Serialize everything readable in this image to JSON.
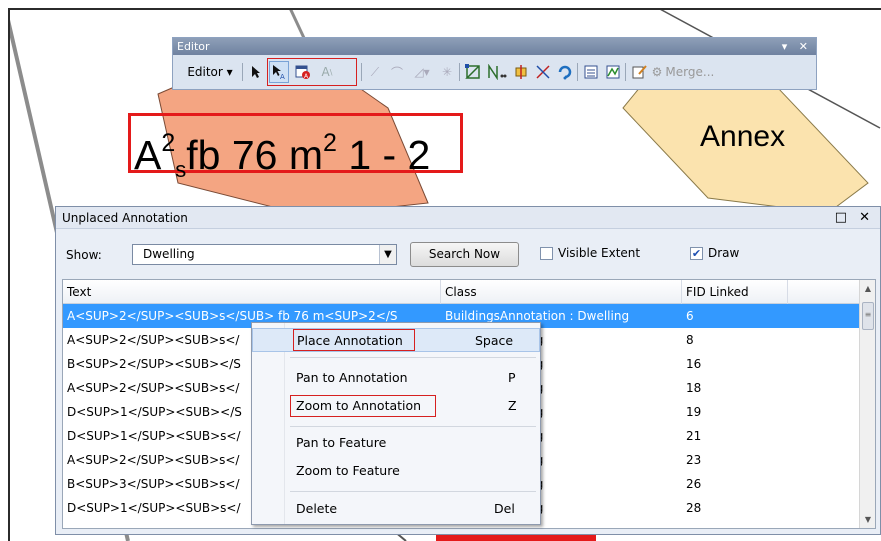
{
  "editor": {
    "title": "Editor",
    "window_controls": "▾ ✕",
    "menu_label": "Editor ▾",
    "merge_label": "Merge...",
    "icons": [
      "edit-tool-icon",
      "edit-annotation-tool-icon",
      "unplaced-annotation-icon",
      "annotation-construction-icon",
      "straight-segment-icon",
      "end-point-arc-icon",
      "construction-tools-icon",
      "trace-icon",
      "topology-edit-icon",
      "topology-icon",
      "split-icon",
      "cut-polygons-icon",
      "rotate-icon",
      "attributes-icon",
      "sketch-properties-icon",
      "create-features-icon",
      "merge-icon"
    ]
  },
  "map": {
    "label_text_parts": {
      "base": "A",
      "sup1": "2",
      "sub1": "s",
      "mid": "fb 76 m",
      "sup2": "2",
      "end": "1 - 2"
    },
    "annex_label": "Annex",
    "colors": {
      "building_salmon": "#f4a582",
      "annex_fill": "#fbe3ae",
      "highlight_red": "#e41a1a"
    }
  },
  "unplaced": {
    "title": "Unplaced Annotation",
    "window_controls": "□ ✕",
    "show_label": "Show:",
    "show_value": "Dwelling",
    "search_button": "Search Now",
    "visible_extent_label": "Visible Extent",
    "visible_extent_checked": false,
    "draw_label": "Draw",
    "draw_checked": true,
    "columns": [
      "Text",
      "Class",
      "FID Linked"
    ],
    "rows": [
      {
        "text": "A<SUP>2</SUP><SUB>s</SUB> fb 76 m<SUP>2</S",
        "class": "BuildingsAnnotation : Dwelling",
        "fid": "6"
      },
      {
        "text": "A<SUP>2</SUP><SUB>s</",
        "class": "tation : Dwelling",
        "fid": "8"
      },
      {
        "text": "B<SUP>2</SUP><SUB></S",
        "class": "tation : Dwelling",
        "fid": "16"
      },
      {
        "text": "A<SUP>2</SUP><SUB>s</",
        "class": "tation : Dwelling",
        "fid": "18"
      },
      {
        "text": "D<SUP>1</SUP><SUB></S",
        "class": "tation : Dwelling",
        "fid": "19"
      },
      {
        "text": "D<SUP>1</SUP><SUB>s</",
        "class": "tation : Dwelling",
        "fid": "21"
      },
      {
        "text": "A<SUP>2</SUP><SUB>s</",
        "class": "tation : Dwelling",
        "fid": "23"
      },
      {
        "text": "B<SUP>3</SUP><SUB>s</",
        "class": "tation : Dwelling",
        "fid": "26"
      },
      {
        "text": "D<SUP>1</SUP><SUB>s</",
        "class": "tation : Dwelling",
        "fid": "28"
      }
    ]
  },
  "context_menu": {
    "items": [
      {
        "label": "Place Annotation",
        "shortcut": "Space"
      },
      {
        "label": "Pan to Annotation",
        "shortcut": "P"
      },
      {
        "label": "Zoom to Annotation",
        "shortcut": "Z"
      },
      {
        "label": "Pan to Feature",
        "shortcut": ""
      },
      {
        "label": "Zoom to Feature",
        "shortcut": ""
      },
      {
        "label": "Delete",
        "shortcut": "Del"
      }
    ]
  }
}
